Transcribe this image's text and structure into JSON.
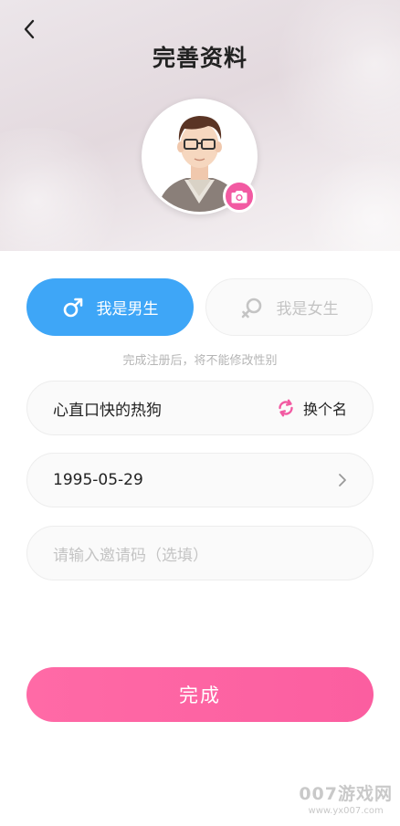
{
  "header": {
    "title": "完善资料"
  },
  "icons": {
    "back": "chevron-left-icon",
    "camera": "camera-icon",
    "male": "male-symbol-icon",
    "female": "female-symbol-icon",
    "refresh": "refresh-icon",
    "arrow": "chevron-right-icon"
  },
  "gender": {
    "male_label": "我是男生",
    "female_label": "我是女生",
    "selected": "male",
    "note": "完成注册后，将不能修改性别"
  },
  "nickname": {
    "value": "心直口快的热狗",
    "change_label": "换个名"
  },
  "birthday": {
    "value": "1995-05-29"
  },
  "invite": {
    "placeholder": "请输入邀请码（选填）"
  },
  "submit": {
    "label": "完成"
  },
  "watermark": {
    "brand": "007游戏网",
    "url": "www.yx007.com"
  },
  "colors": {
    "male_accent": "#3ea6f7",
    "pink_accent": "#fb5ea0",
    "camera_badge": "#f25aa2"
  }
}
